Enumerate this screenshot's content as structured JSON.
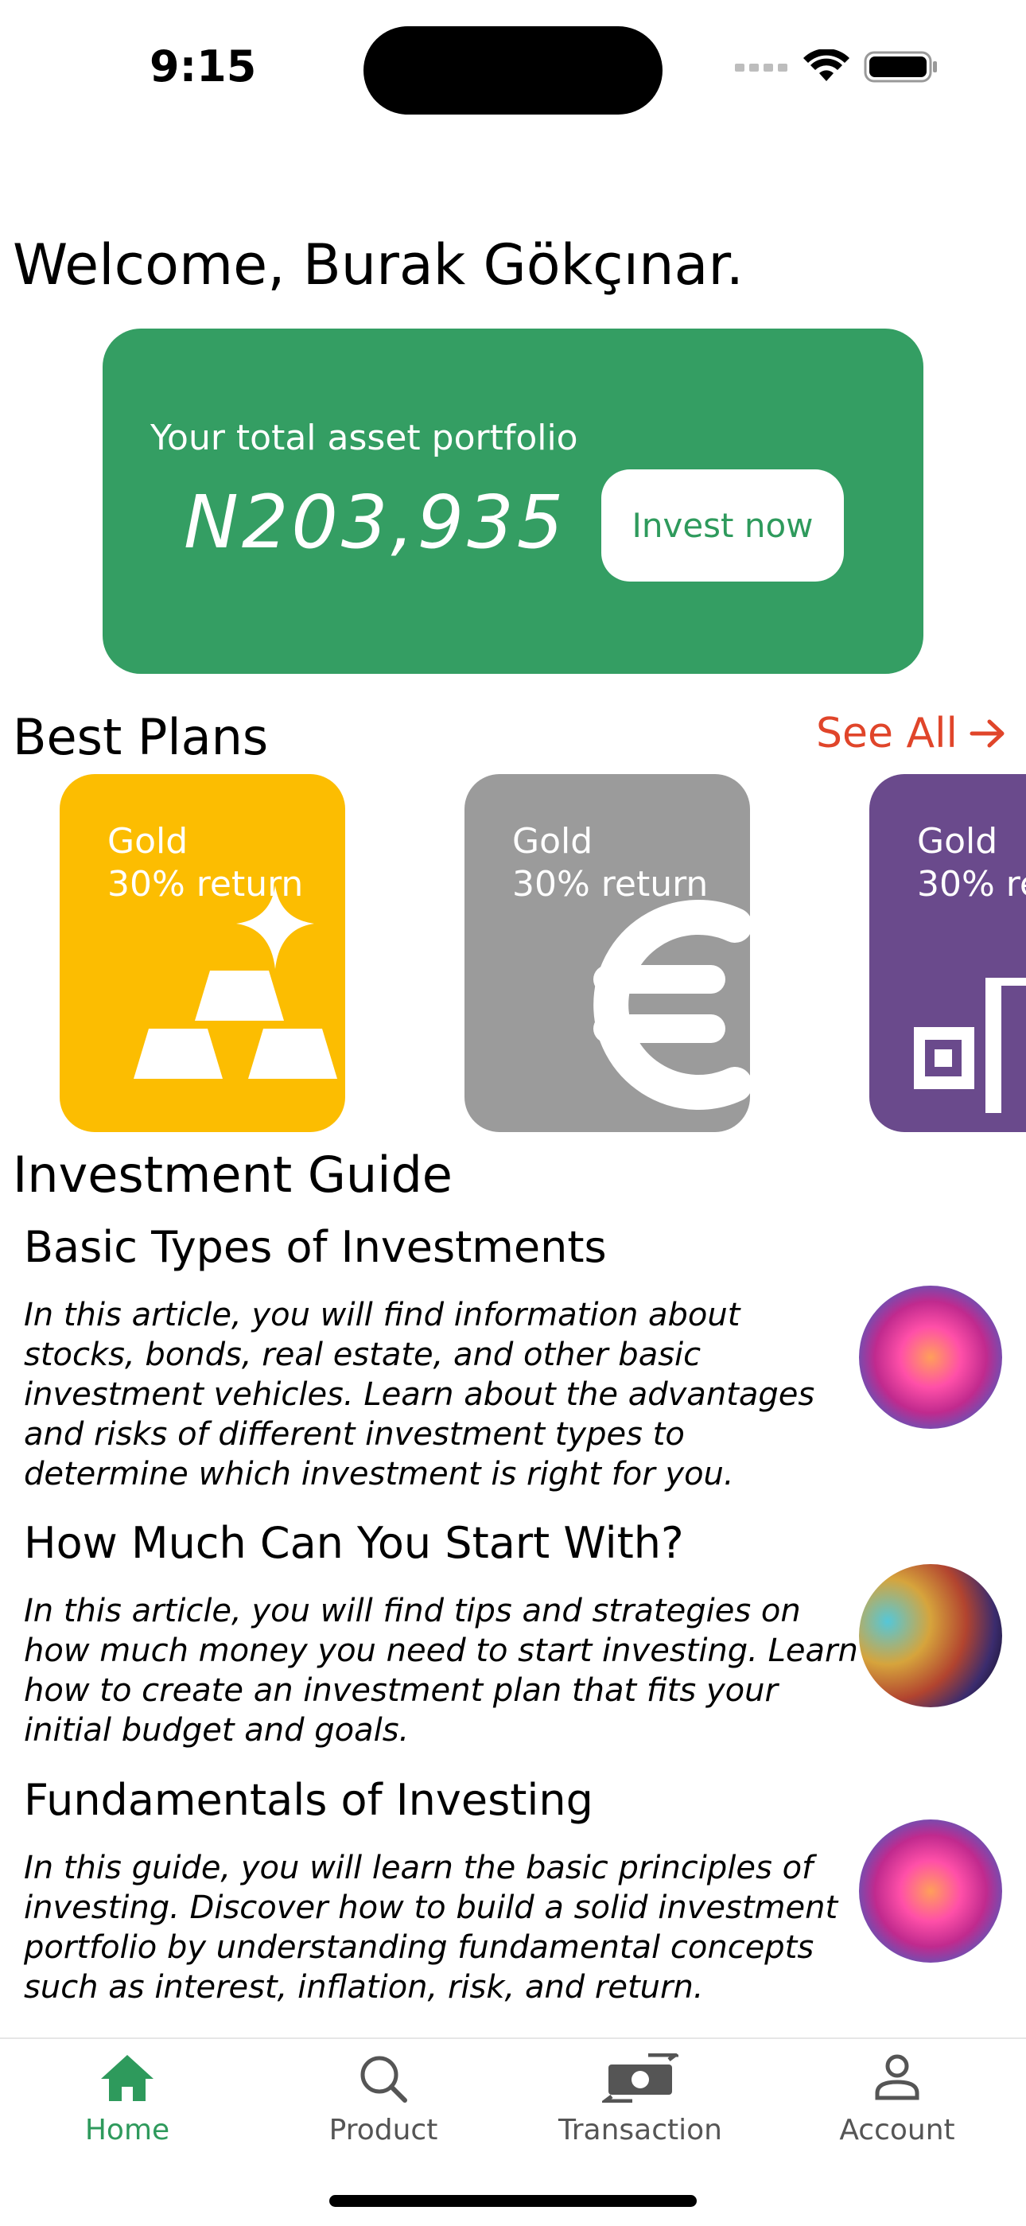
{
  "status_bar": {
    "time": "9:15"
  },
  "welcome": "Welcome, Burak Gökçınar.",
  "portfolio": {
    "label": "Your total asset portfolio",
    "amount": "N203,935",
    "invest_button": "Invest now",
    "card_color": "#349e63"
  },
  "best_plans": {
    "title": "Best Plans",
    "see_all": "See All",
    "plans": [
      {
        "name": "Gold",
        "return": "30% return",
        "color": "#fcbd01",
        "icon": "gold-bars-icon"
      },
      {
        "name": "Gold",
        "return": "30% return",
        "color": "#9b9b9b",
        "icon": "euro-icon"
      },
      {
        "name": "Gold",
        "return": "30% re",
        "color": "#6a4a8c",
        "icon": "bar-chart-icon"
      }
    ]
  },
  "guide": {
    "title": "Investment Guide",
    "articles": [
      {
        "title": "Basic Types of Investments",
        "description": "In this article, you will find information about stocks, bonds, real estate, and other basic investment vehicles. Learn about the advantages and risks of different investment types to determine which investment is right for you."
      },
      {
        "title": "How Much Can You Start With?",
        "description": "In this article, you will find tips and strategies on how much money you need to start investing. Learn how to create an investment plan that fits your initial budget and goals."
      },
      {
        "title": "Fundamentals of Investing",
        "description": "In this guide, you will learn the basic principles of investing. Discover how to build a solid investment portfolio by understanding fundamental concepts such as interest, inflation, risk, and return."
      }
    ]
  },
  "nav": {
    "items": [
      {
        "label": "Home",
        "icon": "home-icon",
        "active": true
      },
      {
        "label": "Product",
        "icon": "search-icon",
        "active": false
      },
      {
        "label": "Transaction",
        "icon": "money-transfer-icon",
        "active": false
      },
      {
        "label": "Account",
        "icon": "person-icon",
        "active": false
      }
    ],
    "active_color": "#2e9a5c"
  },
  "colors": {
    "see_all": "#e0452a"
  }
}
